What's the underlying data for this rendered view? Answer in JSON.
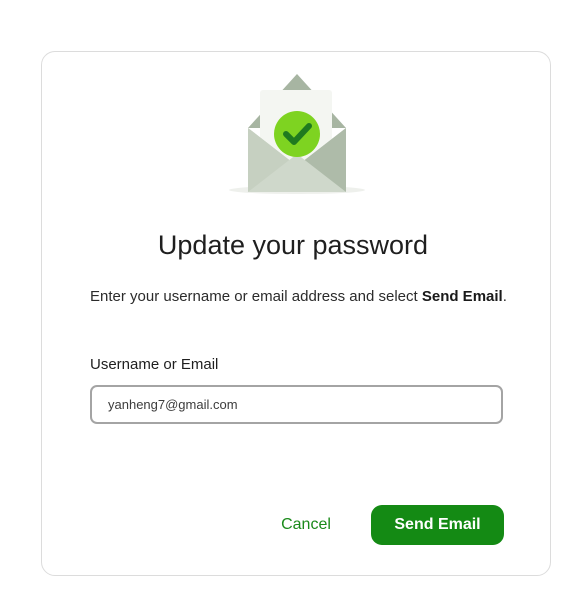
{
  "dialog": {
    "title": "Update your password",
    "instructions_prefix": "Enter your username or email address and select ",
    "instructions_strong": "Send Email",
    "instructions_suffix": ".",
    "field_label": "Username or Email",
    "field_value": "yanheng7@gmail.com",
    "cancel_label": "Cancel",
    "send_label": "Send Email"
  },
  "illustration": {
    "icon": "envelope-with-checkmark-icon"
  },
  "colors": {
    "accent": "#148a14",
    "link": "#1a8a1a",
    "check": "#7ed321"
  }
}
